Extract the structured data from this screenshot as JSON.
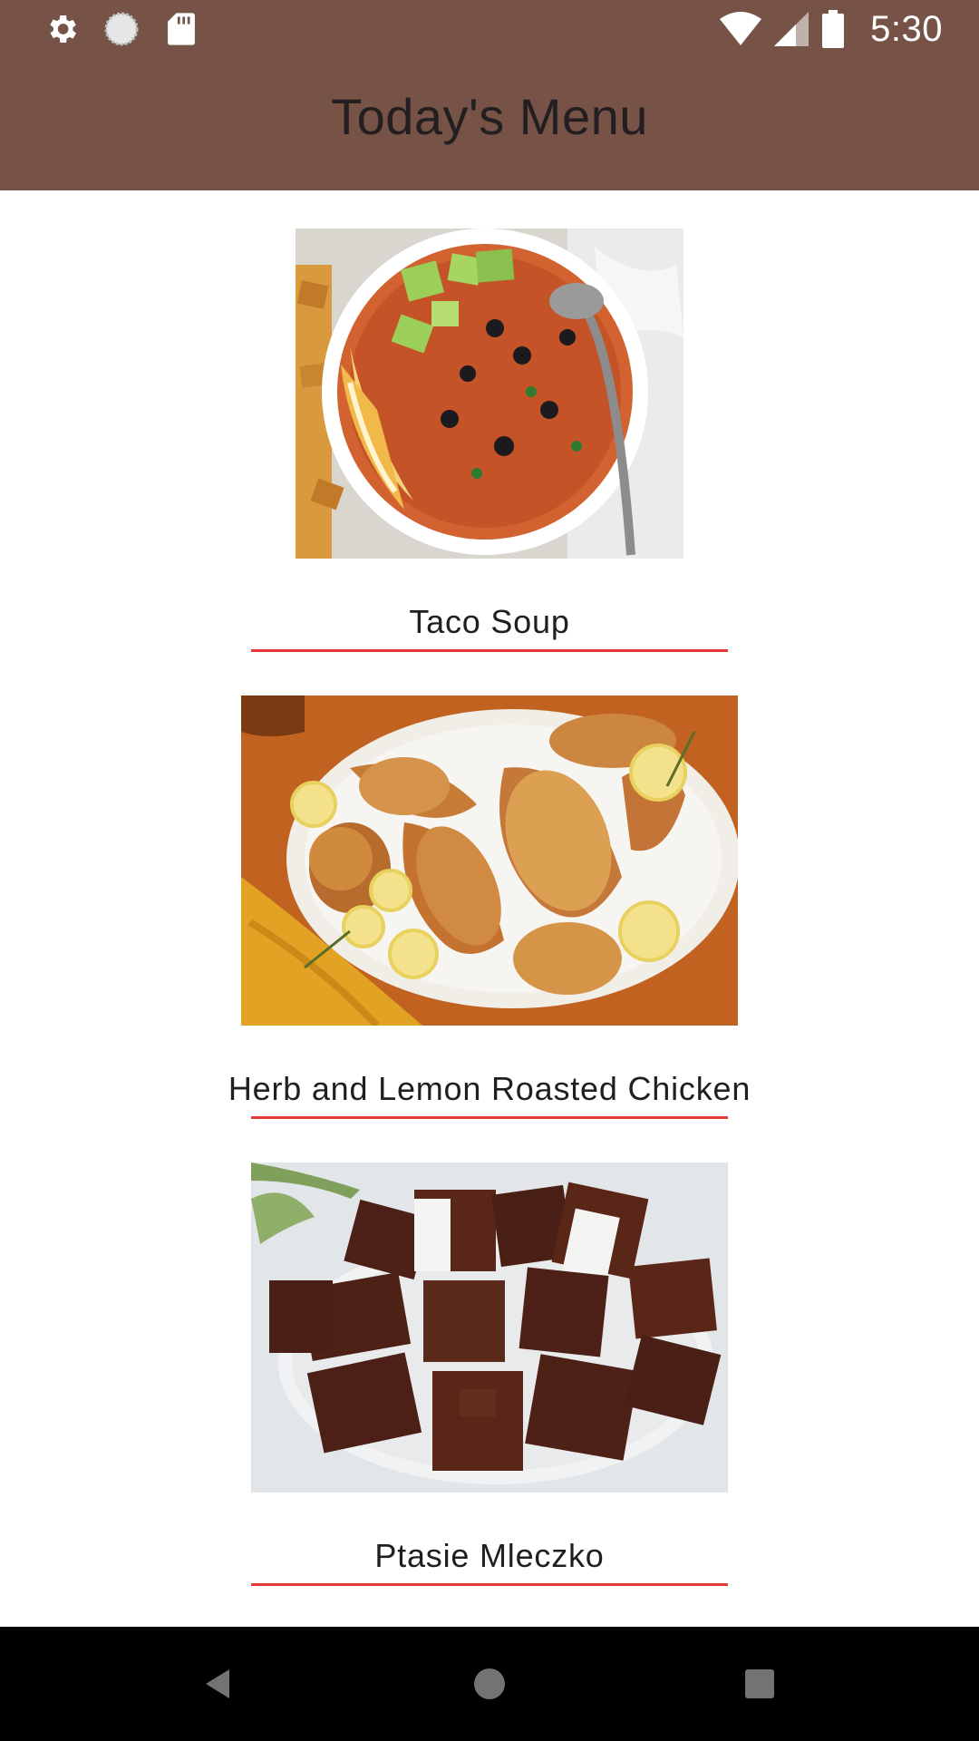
{
  "status_bar": {
    "time": "5:30",
    "icons": [
      "gear-icon",
      "loading-icon",
      "sd-card-icon",
      "wifi-icon",
      "signal-icon",
      "battery-icon"
    ]
  },
  "app_bar": {
    "title": "Today's Menu"
  },
  "menu": {
    "items": [
      {
        "name": "Taco Soup",
        "image": "taco-soup-photo"
      },
      {
        "name": "Herb and Lemon Roasted Chicken",
        "image": "roasted-chicken-photo"
      },
      {
        "name": "Ptasie Mleczko",
        "image": "ptasie-mleczko-photo"
      }
    ]
  },
  "nav_bar": {
    "buttons": [
      "back-icon",
      "home-icon",
      "recents-icon"
    ]
  },
  "colors": {
    "app_bar": "#765247",
    "title_text": "#231f20",
    "underline": "#e53935",
    "nav_bar": "#000000"
  }
}
